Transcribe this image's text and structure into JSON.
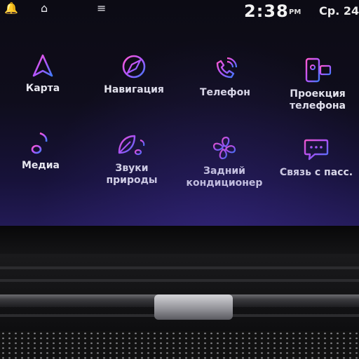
{
  "topbar": {
    "icons": [
      "notification-bell-icon",
      "home-icon",
      "menu-icon"
    ],
    "time": "2:38",
    "ampm": "PM",
    "date": "Ср. 24"
  },
  "apps": [
    {
      "label": "Карта",
      "icon": "map-arrow-icon"
    },
    {
      "label": "Навигация",
      "icon": "compass-icon"
    },
    {
      "label": "Телефон",
      "icon": "phone-icon"
    },
    {
      "label": "Проекция\nтелефона",
      "icon": "phone-projection-icon"
    },
    {
      "label": "Медиа",
      "icon": "music-note-icon"
    },
    {
      "label": "Звуки\nприроды",
      "icon": "nature-sounds-icon"
    },
    {
      "label": "Задний\nкондиционер",
      "icon": "fan-icon"
    },
    {
      "label": "Связь с пасс.",
      "icon": "chat-icon"
    }
  ],
  "colors": {
    "icon_gradient_start": "#ff5bd0",
    "icon_gradient_mid": "#b455ff",
    "icon_gradient_end": "#3f7bff",
    "screen_bg": "#0f0d1c"
  }
}
